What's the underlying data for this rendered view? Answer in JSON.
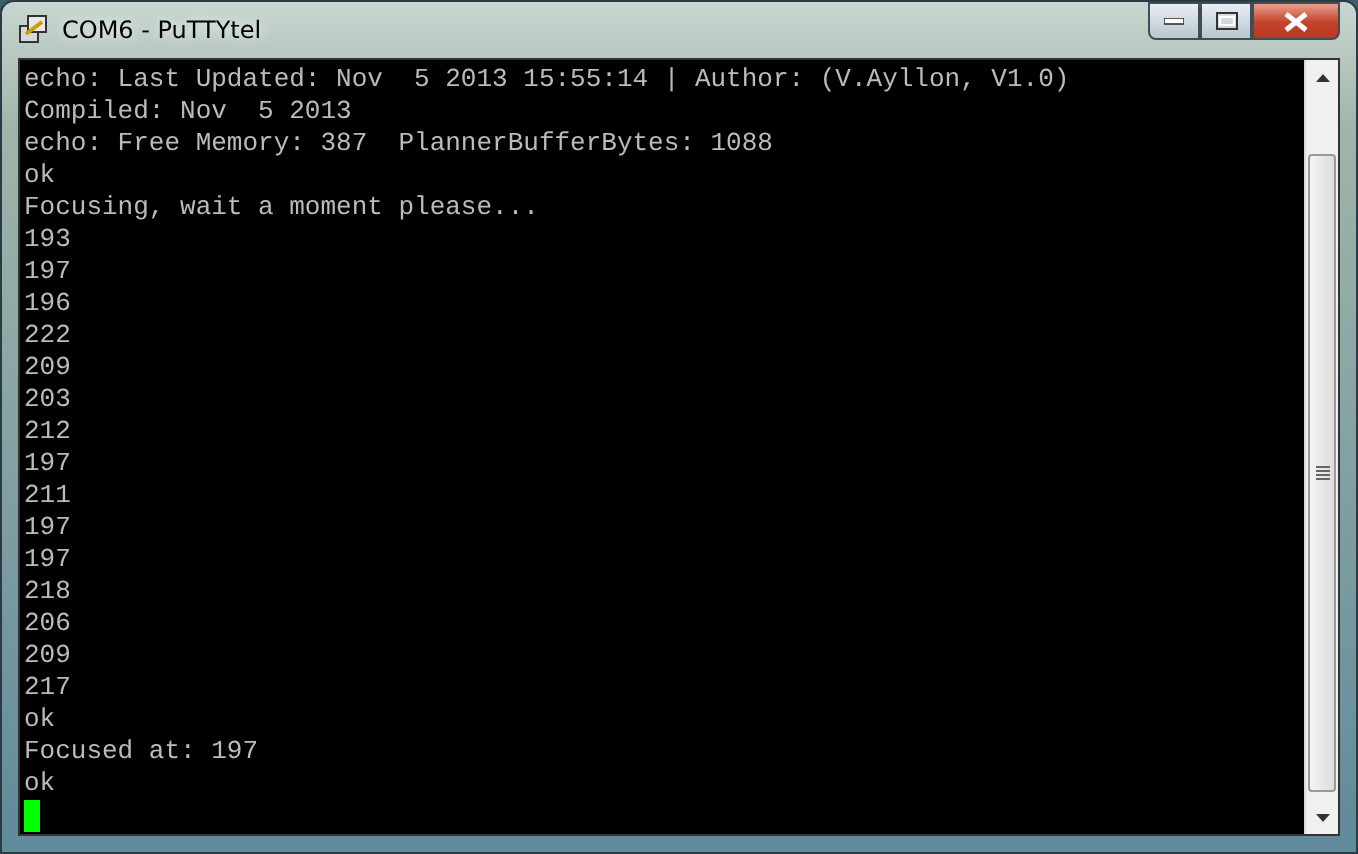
{
  "window": {
    "title": "COM6 - PuTTYtel"
  },
  "terminal": {
    "lines": [
      "echo: Last Updated: Nov  5 2013 15:55:14 | Author: (V.Ayllon, V1.0)",
      "Compiled: Nov  5 2013",
      "echo: Free Memory: 387  PlannerBufferBytes: 1088",
      "ok",
      "Focusing, wait a moment please...",
      "193",
      "197",
      "196",
      "222",
      "209",
      "203",
      "212",
      "197",
      "211",
      "197",
      "197",
      "218",
      "206",
      "209",
      "217",
      "ok",
      "Focused at: 197",
      "ok"
    ],
    "cursor": {
      "color": "#00ff00"
    }
  }
}
